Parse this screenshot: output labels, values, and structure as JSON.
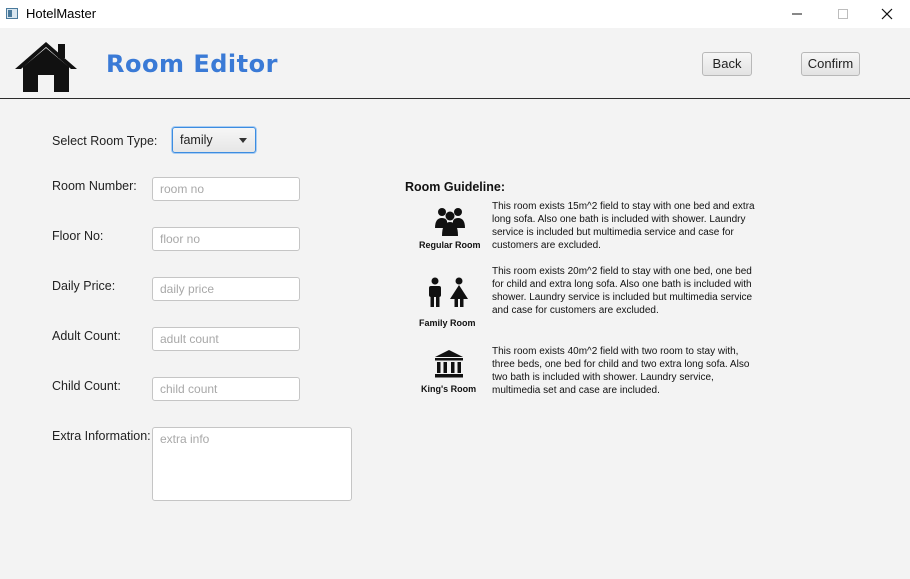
{
  "window": {
    "title": "HotelMaster"
  },
  "header": {
    "title": "Room Editor",
    "back_label": "Back",
    "confirm_label": "Confirm"
  },
  "form": {
    "room_type_label": "Select Room Type:",
    "room_type_value": "family",
    "room_number_label": "Room Number:",
    "room_number_placeholder": "room no",
    "floor_label": "Floor No:",
    "floor_placeholder": "floor no",
    "price_label": "Daily Price:",
    "price_placeholder": "daily price",
    "adult_label": "Adult Count:",
    "adult_placeholder": "adult count",
    "child_label": "Child Count:",
    "child_placeholder": "child count",
    "extra_label": "Extra Information:",
    "extra_placeholder": "extra info"
  },
  "guideline": {
    "title": "Room Guideline:",
    "regular": {
      "caption": "Regular Room",
      "icon": "group-icon",
      "text": "This room exists 15m^2 field to stay with one bed and extra long sofa. Also one bath is included with shower. Laundry service is included but multimedia service and case for customers are excluded."
    },
    "family": {
      "caption": "Family Room",
      "icon": "family-icon",
      "text": "This room exists 20m^2 field to stay with one bed, one bed for child and extra long sofa. Also one bath is included with shower. Laundry service is included but multimedia service and case for customers are excluded."
    },
    "king": {
      "caption": "King's Room",
      "icon": "palace-icon",
      "text": "This room exists 40m^2 field with two room to stay with, three beds, one bed for child and two extra long sofa. Also two bath is included with shower. Laundry service, multimedia set and case are included."
    }
  },
  "colors": {
    "accent": "#3a7ad6",
    "focus": "#3c8ce0"
  }
}
